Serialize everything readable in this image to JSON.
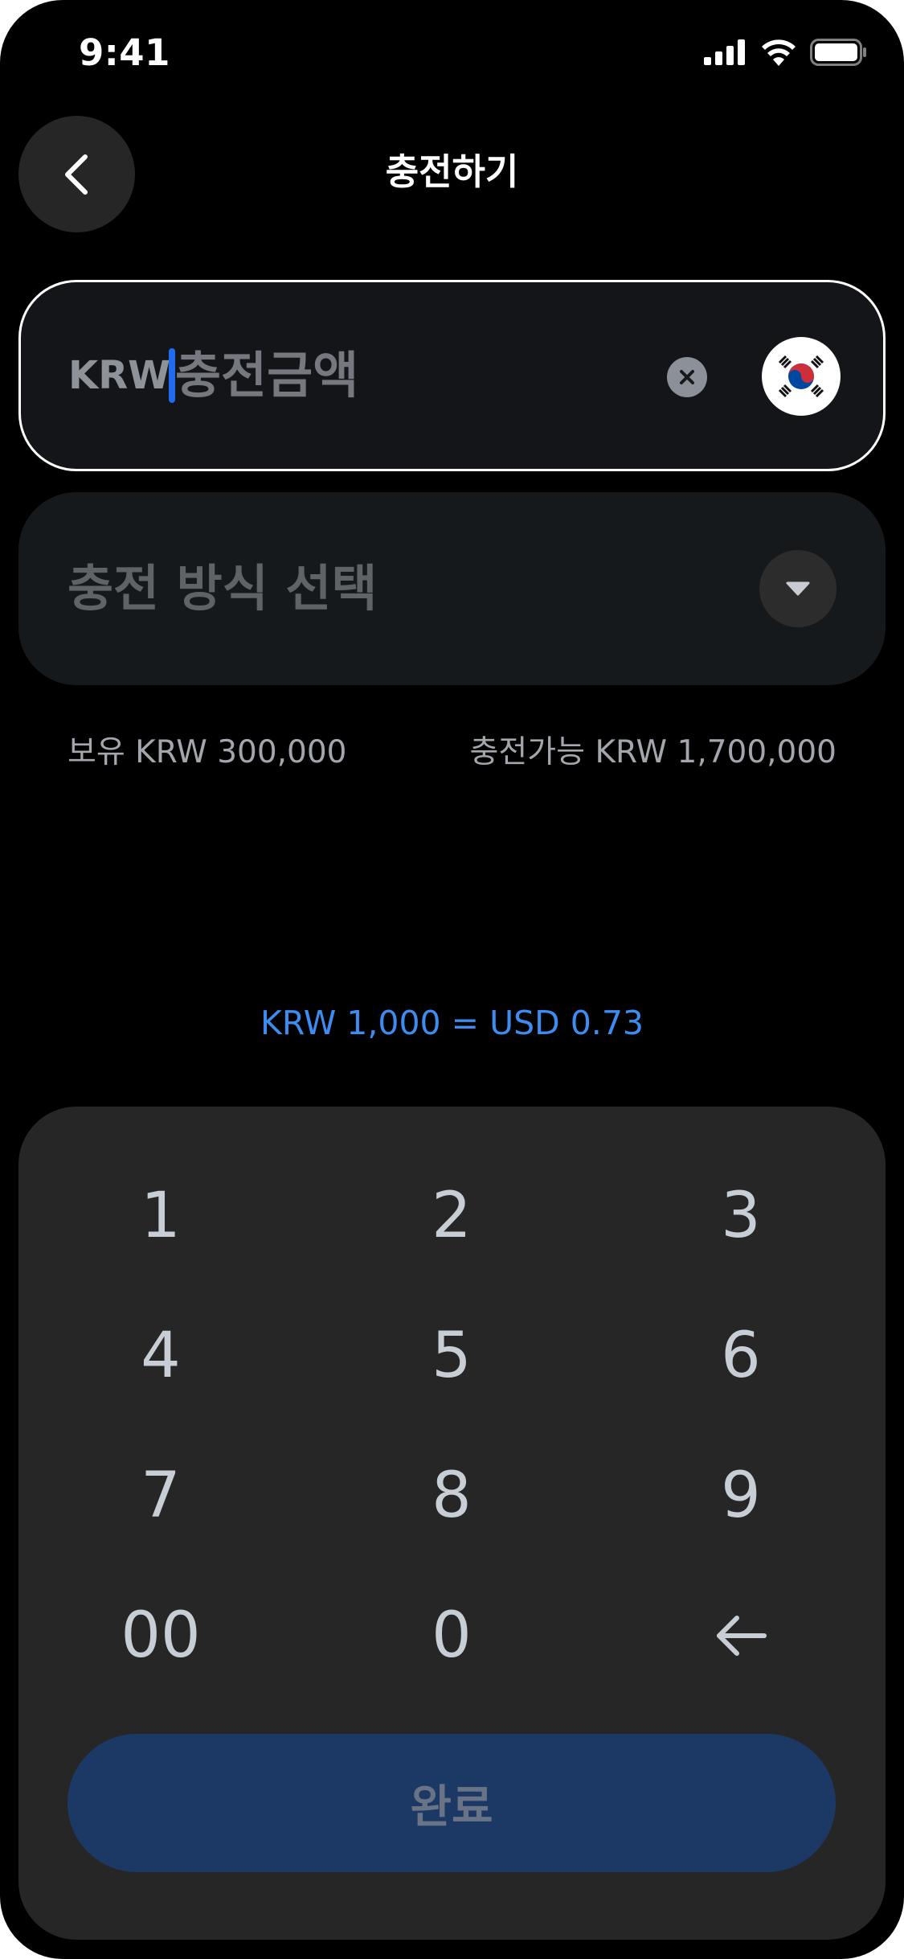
{
  "status_bar": {
    "time": "9:41",
    "icons": [
      "cellular-signal-icon",
      "wifi-icon",
      "battery-icon"
    ]
  },
  "header": {
    "back_icon": "chevron-left-icon",
    "title": "충전하기"
  },
  "amount_input": {
    "currency": "KRW",
    "placeholder": "충전금액",
    "clear_icon": "close-icon",
    "flag_icon": "south-korea-flag-icon"
  },
  "method_select": {
    "label": "충전 방식 선택",
    "dropdown_icon": "caret-down-icon"
  },
  "balance": {
    "held": "보유 KRW 300,000",
    "available": "충전가능 KRW 1,700,000"
  },
  "exchange_rate": "KRW 1,000 = USD 0.73",
  "keypad": {
    "keys": [
      "1",
      "2",
      "3",
      "4",
      "5",
      "6",
      "7",
      "8",
      "9",
      "00",
      "0"
    ],
    "backspace_icon": "arrow-left-icon",
    "done_label": "완료"
  },
  "colors": {
    "background": "#000000",
    "accent_blue": "#3d8cf0",
    "caret_blue": "#1f6cf0",
    "done_button": "#1c3966",
    "keypad_background": "#262626"
  }
}
